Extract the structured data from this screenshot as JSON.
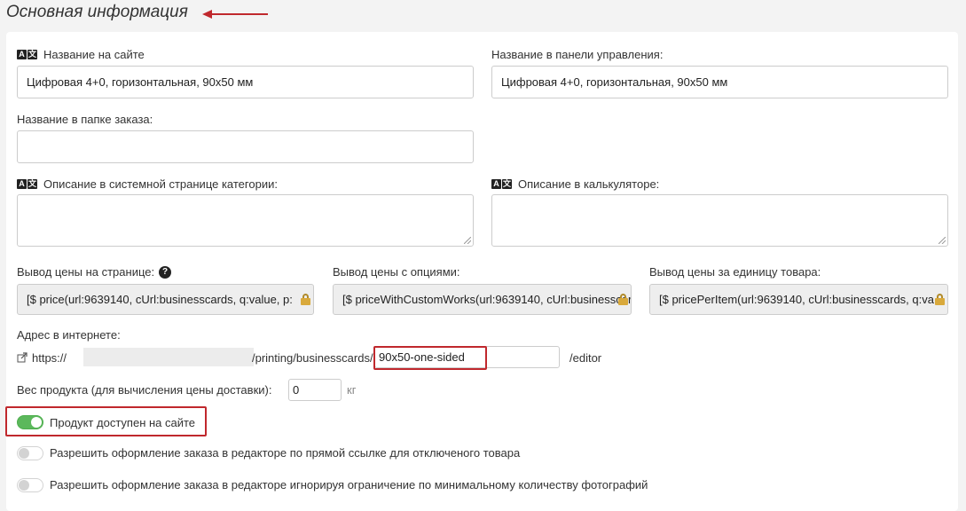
{
  "section": {
    "title": "Основная информация"
  },
  "fields": {
    "site_name": {
      "label": "Название на сайте",
      "value": "Цифровая 4+0, горизонтальная, 90х50 мм"
    },
    "admin_name": {
      "label": "Название в панели управления:",
      "value": "Цифровая 4+0, горизонтальная, 90х50 мм"
    },
    "folder_name": {
      "label": "Название в папке заказа:",
      "value": ""
    },
    "category_desc": {
      "label": "Описание в системной странице категории:",
      "value": ""
    },
    "calc_desc": {
      "label": "Описание в калькуляторе:",
      "value": ""
    },
    "price_on_page": {
      "label": "Вывод цены на странице:",
      "value": "[$ price(url:9639140, cUrl:businesscards, q:value, p:"
    },
    "price_with_options": {
      "label": "Вывод цены с опциями:",
      "value": "[$ priceWithCustomWorks(url:9639140, cUrl:businesscards"
    },
    "price_per_item": {
      "label": "Вывод цены за единицу товара:",
      "value": "[$ pricePerItem(url:9639140, cUrl:businesscards, q:va"
    }
  },
  "url": {
    "label": "Адрес в интернете:",
    "prefix": "https://",
    "path": "/printing/businesscards/",
    "slug": "90x50-one-sided",
    "suffix": "/editor"
  },
  "weight": {
    "label": "Вес продукта (для вычисления цены доставки):",
    "value": "0",
    "unit": "кг"
  },
  "toggles": [
    {
      "label": "Продукт доступен на сайте",
      "on": true
    },
    {
      "label": "Разрешить оформление заказа в редакторе по прямой ссылке для отключеного товара",
      "on": false
    },
    {
      "label": "Разрешить оформление заказа в редакторе игнорируя ограничение по минимальному количеству фотографий",
      "on": false
    }
  ],
  "colors": {
    "accent_red": "#c0282d",
    "toggle_on": "#5cb85c"
  },
  "icons": {
    "translate": "translate-icon",
    "help": "help-icon",
    "lock": "lock-icon",
    "external_link": "external-link-icon",
    "arrow": "arrow-left-icon"
  }
}
